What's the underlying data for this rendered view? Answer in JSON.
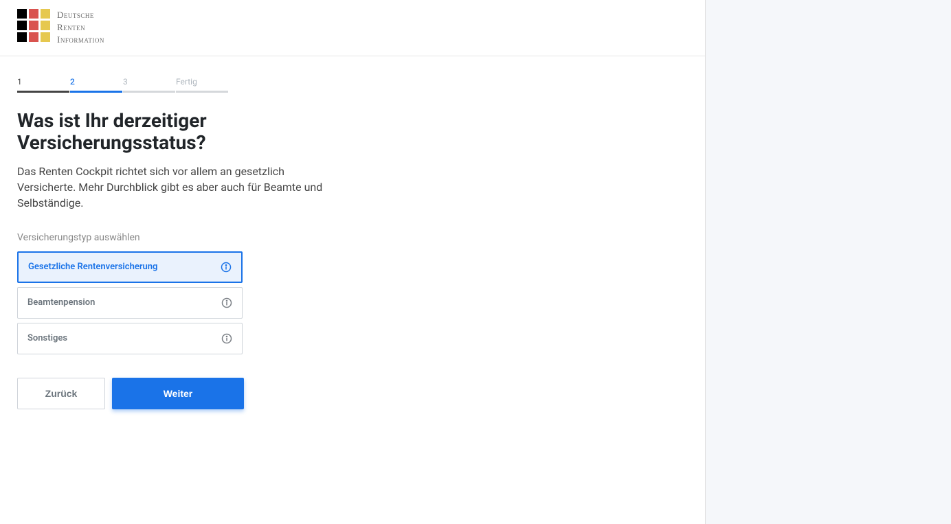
{
  "logo": {
    "line1": "Deutsche",
    "line2": "Renten",
    "line3": "Information"
  },
  "steps": [
    {
      "label": "1",
      "state": "done"
    },
    {
      "label": "2",
      "state": "active"
    },
    {
      "label": "3",
      "state": "pending"
    },
    {
      "label": "Fertig",
      "state": "pending"
    }
  ],
  "heading": "Was ist Ihr derzeitiger Versicherungsstatus?",
  "subtitle": "Das Renten Cockpit richtet sich vor allem an gesetzlich Versicherte. Mehr Durchblick gibt es aber auch für Beamte und Selbständige.",
  "fieldLabel": "Versicherungstyp auswählen",
  "options": [
    {
      "label": "Gesetzliche Rentenversicherung",
      "selected": true
    },
    {
      "label": "Beamtenpension",
      "selected": false
    },
    {
      "label": "Sonstiges",
      "selected": false
    }
  ],
  "buttons": {
    "back": "Zurück",
    "next": "Weiter"
  },
  "colors": {
    "primary": "#1a73e8",
    "flag_black": "#000000",
    "flag_red": "#d9534f",
    "flag_gold": "#e6c84f"
  }
}
